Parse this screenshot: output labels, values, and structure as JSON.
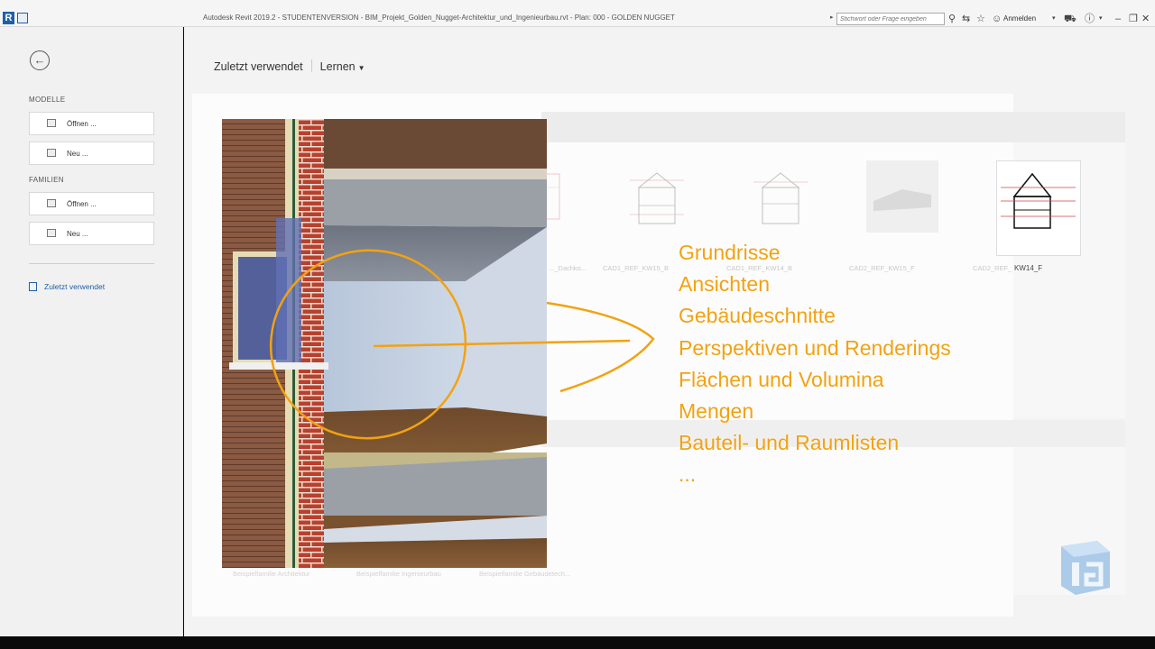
{
  "titlebar": {
    "app_logo": "R",
    "title": "Autodesk Revit 2019.2 - STUDENTENVERSION - BIM_Projekt_Golden_Nugget-Architektur_und_Ingenieurbau.rvt - Plan: 000 - GOLDEN NUGGET",
    "search_placeholder": "Stichwort oder Frage eingeben",
    "signin": "Anmelden",
    "icons": [
      "binoculars-icon",
      "exchange-icon",
      "star-icon",
      "user-icon",
      "cart-icon",
      "help-icon",
      "minimize-icon",
      "restore-icon",
      "close-icon"
    ]
  },
  "sidebar": {
    "section_models": "MODELLE",
    "models_open": "Öffnen ...",
    "models_new": "Neu ...",
    "section_families": "FAMILIEN",
    "families_open": "Öffnen ...",
    "families_new": "Neu ...",
    "recent": "Zuletzt verwendet"
  },
  "main": {
    "tab_recent": "Zuletzt verwendet",
    "tab_learn": "Lernen"
  },
  "recent_files": [
    {
      "caption": "..._Dachko..."
    },
    {
      "caption": "CAD1_REF_KW15_B"
    },
    {
      "caption": "CAD1_REF_KW14_B"
    },
    {
      "caption": "CAD2_REF_KW15_F"
    },
    {
      "caption": "CAD2_REF_"
    },
    {
      "caption": "KW14_F"
    }
  ],
  "families": [
    {
      "caption": "Beispielfamilie Architektur"
    },
    {
      "caption": "Beispielfamilie Ingenieurbau"
    },
    {
      "caption": "Beispielfamilie Gebäudetech..."
    }
  ],
  "overlay": {
    "items": [
      "Grundrisse",
      "Ansichten",
      "Gebäudeschnitte",
      "Perspektiven und Renderings",
      "Flächen und Volumina",
      "Mengen",
      "Bauteil- und Raumlisten",
      "..."
    ],
    "accent_color": "#f2a212"
  }
}
